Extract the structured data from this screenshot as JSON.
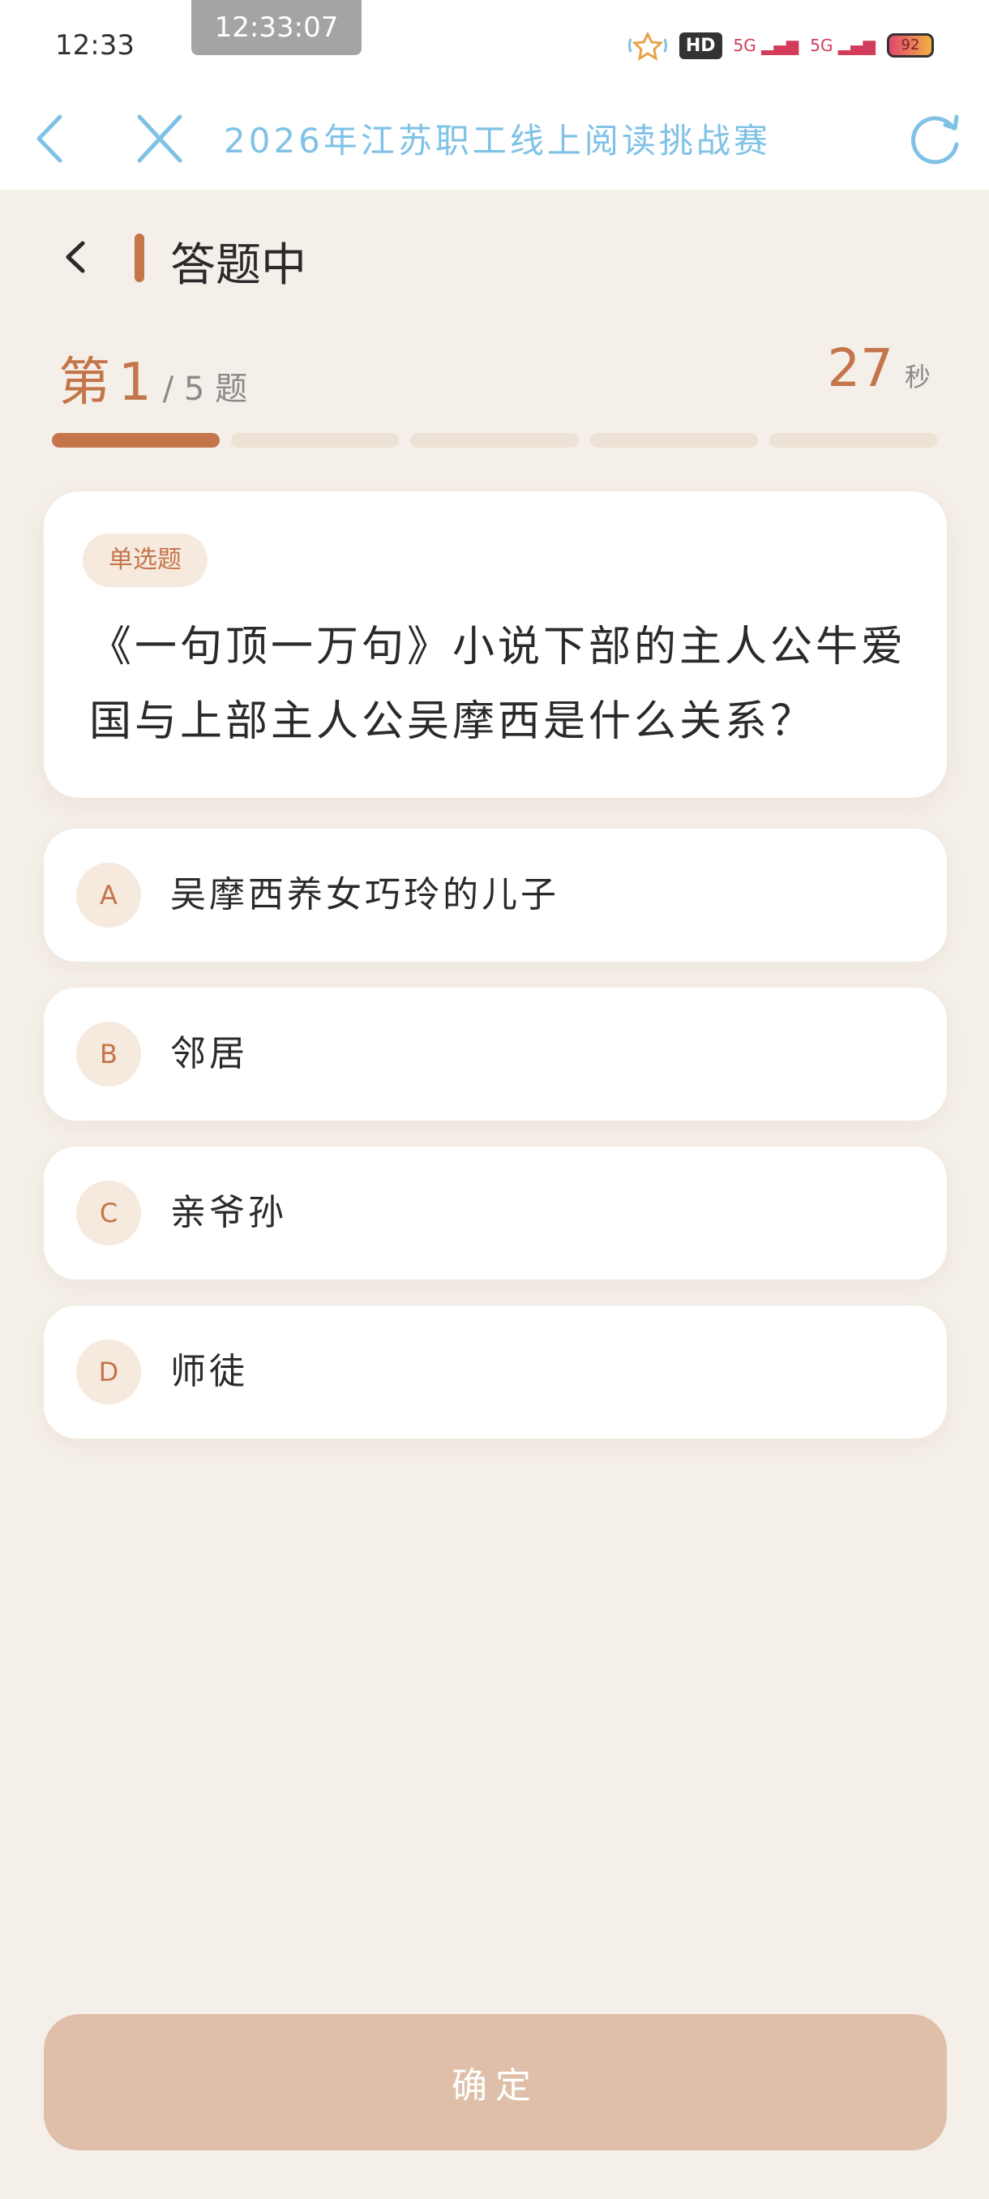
{
  "status_bar": {
    "time": "12:33",
    "time_pill": "12:33:07",
    "hd_label": "HD",
    "signal_1": "5G",
    "signal_2": "5G",
    "battery": "92"
  },
  "nav": {
    "title": "2026年江苏职工线上阅读挑战赛"
  },
  "page": {
    "title": "答题中"
  },
  "progress": {
    "prefix": "第",
    "current": "1",
    "total_text": "/ 5 题",
    "current_index": 1,
    "total": 5
  },
  "timer": {
    "value": "27",
    "unit": "秒"
  },
  "question": {
    "type_tag": "单选题",
    "text": "《一句顶一万句》小说下部的主人公牛爱国与上部主人公吴摩西是什么关系？"
  },
  "options": [
    {
      "letter": "A",
      "text": "吴摩西养女巧玲的儿子"
    },
    {
      "letter": "B",
      "text": "邻居"
    },
    {
      "letter": "C",
      "text": "亲爷孙"
    },
    {
      "letter": "D",
      "text": "师徒"
    }
  ],
  "confirm_label": "确定",
  "colors": {
    "accent": "#c4754a",
    "nav_blue": "#7fc2e6",
    "background": "#f4efe8",
    "button_disabled": "#dfbfa9"
  }
}
